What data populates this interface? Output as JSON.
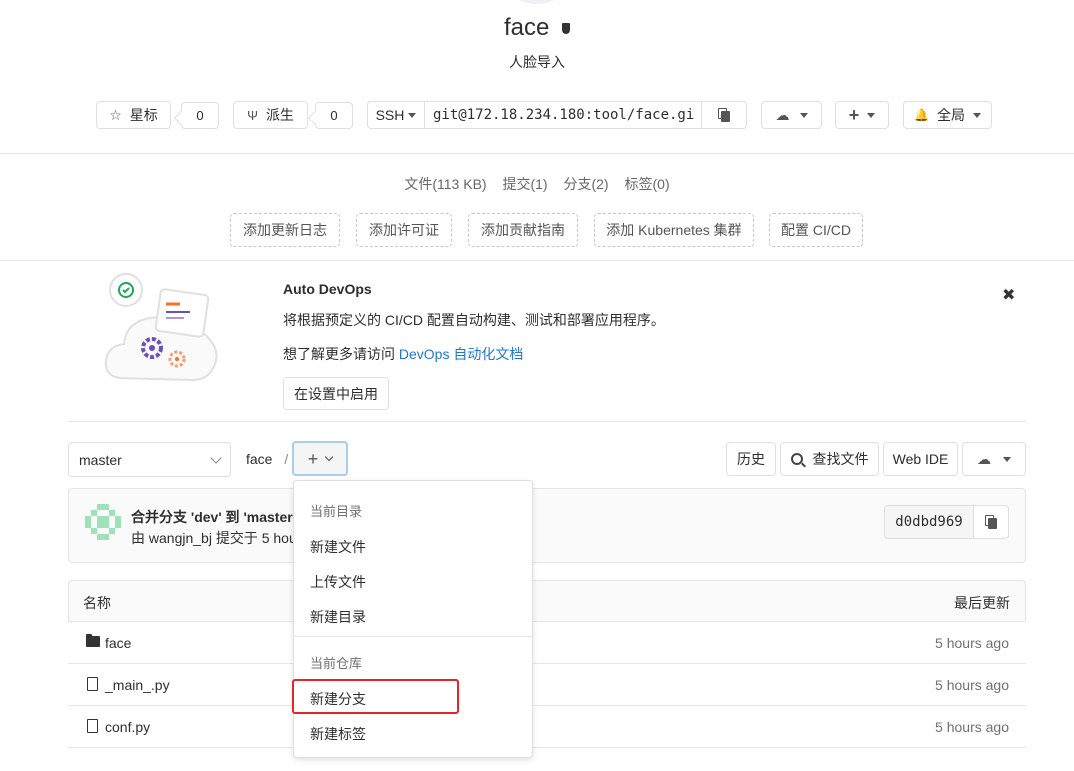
{
  "project": {
    "title": "face",
    "subtitle": "人脸导入"
  },
  "actions": {
    "star_label": "星标",
    "star_count": "0",
    "fork_label": "派生",
    "fork_count": "0",
    "protocol": "SSH",
    "clone_url": "git@172.18.234.180:tool/face.gi",
    "notify_label": "全局"
  },
  "stats": {
    "files": "文件(113 KB)",
    "commits": "提交(1)",
    "branches": "分支(2)",
    "tags": "标签(0)"
  },
  "quick_add": {
    "changelog": "添加更新日志",
    "license": "添加许可证",
    "contributing": "添加贡献指南",
    "kubernetes": "添加 Kubernetes 集群",
    "cicd": "配置 CI/CD"
  },
  "devops": {
    "title": "Auto DevOps",
    "description": "将根据预定义的 CI/CD 配置自动构建、测试和部署应用程序。",
    "learn_more_prefix": "想了解更多请访问 ",
    "learn_more_link": "DevOps 自动化文档",
    "enable_button": "在设置中启用"
  },
  "tree": {
    "branch": "master",
    "path_root": "face",
    "path_sep": "/",
    "history": "历史",
    "find_file": "查找文件",
    "web_ide": "Web IDE"
  },
  "commit": {
    "message": "合并分支 'dev' 到 'master'",
    "author_line": "由 wangjn_bj 提交于 5 hou",
    "sha": "d0dbd969"
  },
  "table": {
    "col_name": "名称",
    "col_updated": "最后更新",
    "rows": [
      {
        "name": "face",
        "updated": "5 hours ago"
      },
      {
        "name": "_main_.py",
        "updated": "5 hours ago"
      },
      {
        "name": "conf.py",
        "updated": "5 hours ago"
      }
    ]
  },
  "dropdown": {
    "section_dir": "当前目录",
    "new_file": "新建文件",
    "upload_file": "上传文件",
    "new_dir": "新建目录",
    "section_repo": "当前仓库",
    "new_branch": "新建分支",
    "new_tag": "新建标签"
  },
  "colors": {
    "accent": "#1f78d1",
    "highlight": "#e3262a"
  }
}
